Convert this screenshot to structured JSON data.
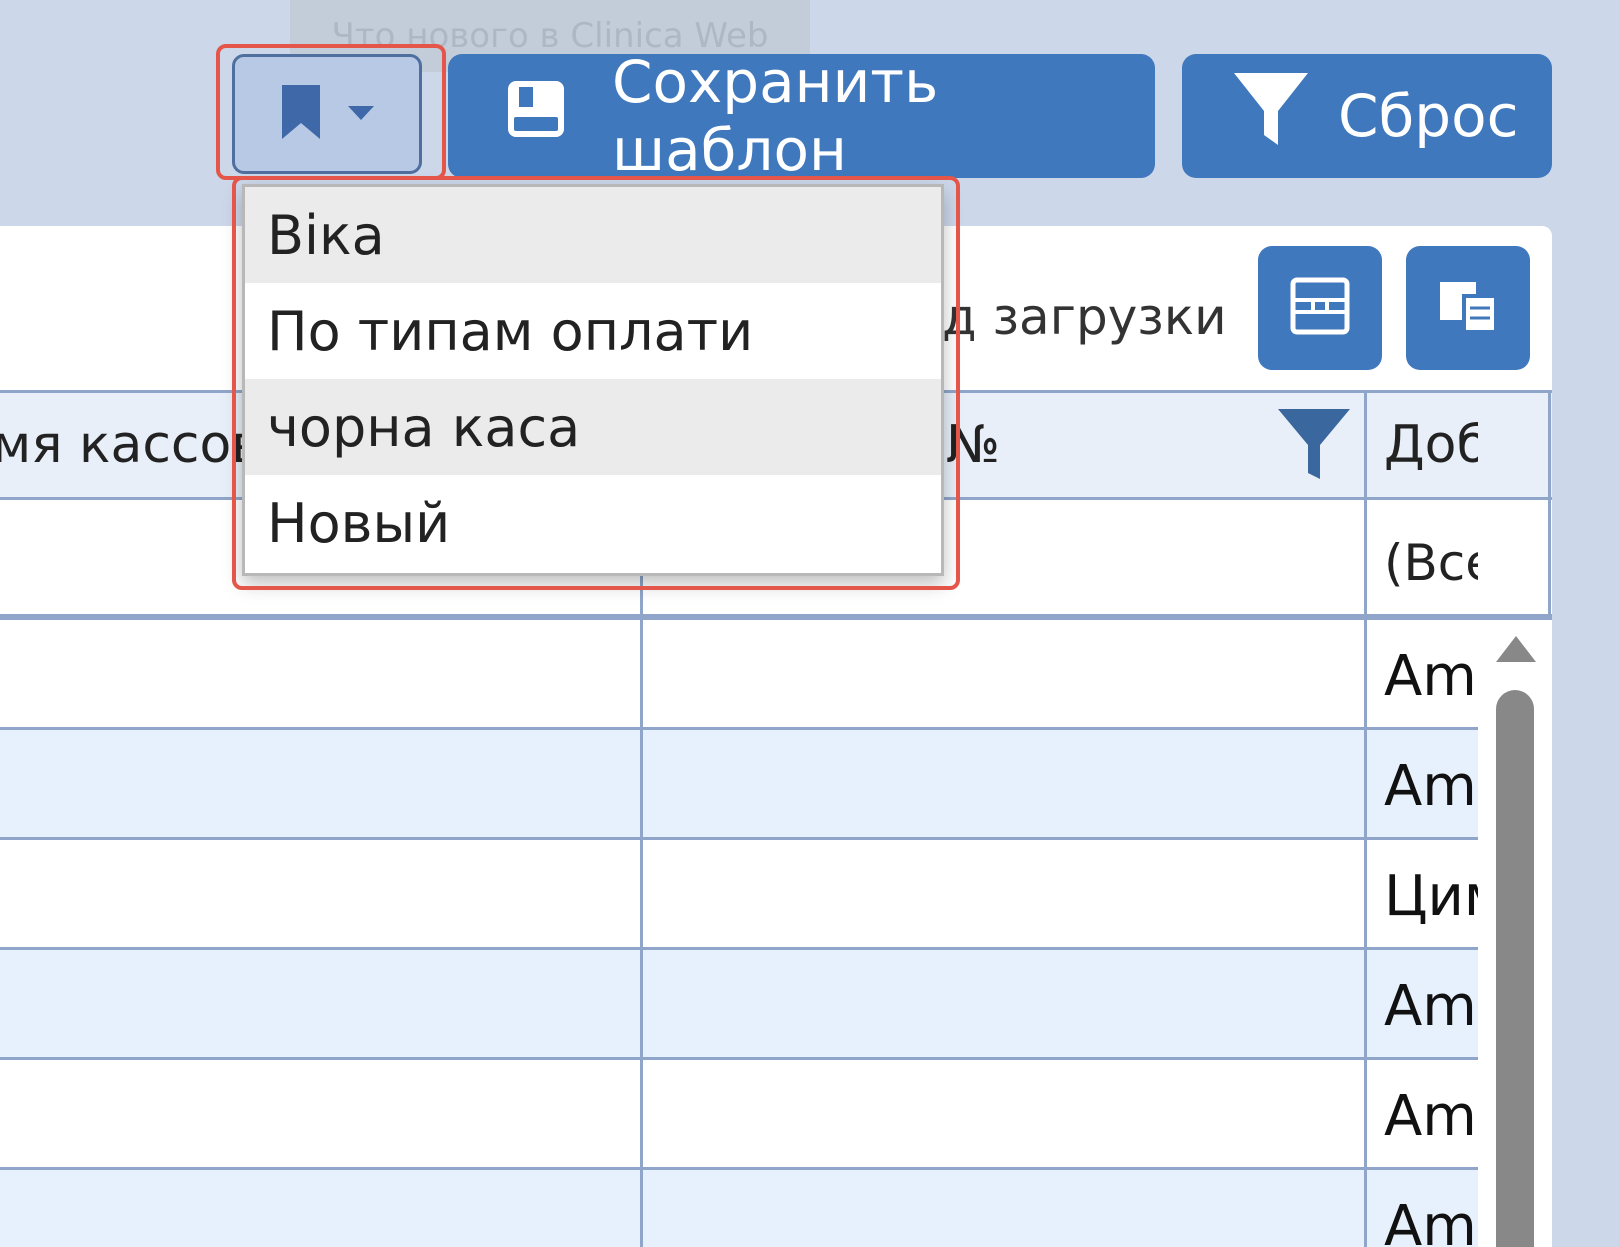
{
  "tooltip": {
    "text": "Что нового в Clinica Web"
  },
  "toolbar": {
    "save_template_label": "Сохранить шаблон",
    "reset_label": "Сброс"
  },
  "templates_menu": {
    "items": [
      "Віка",
      "По типам оплати",
      "чорна каса",
      "Новый"
    ]
  },
  "panel": {
    "load_mode_label": "д загрузки"
  },
  "grid": {
    "columns": [
      "мя кассов",
      "№",
      "Доб"
    ],
    "filter_value": "(Все",
    "rows": [
      "Am",
      "Am",
      "Цим",
      "Am",
      "Am",
      "Am"
    ]
  },
  "colors": {
    "accent": "#3f78bd",
    "highlight": "#e4564a"
  }
}
